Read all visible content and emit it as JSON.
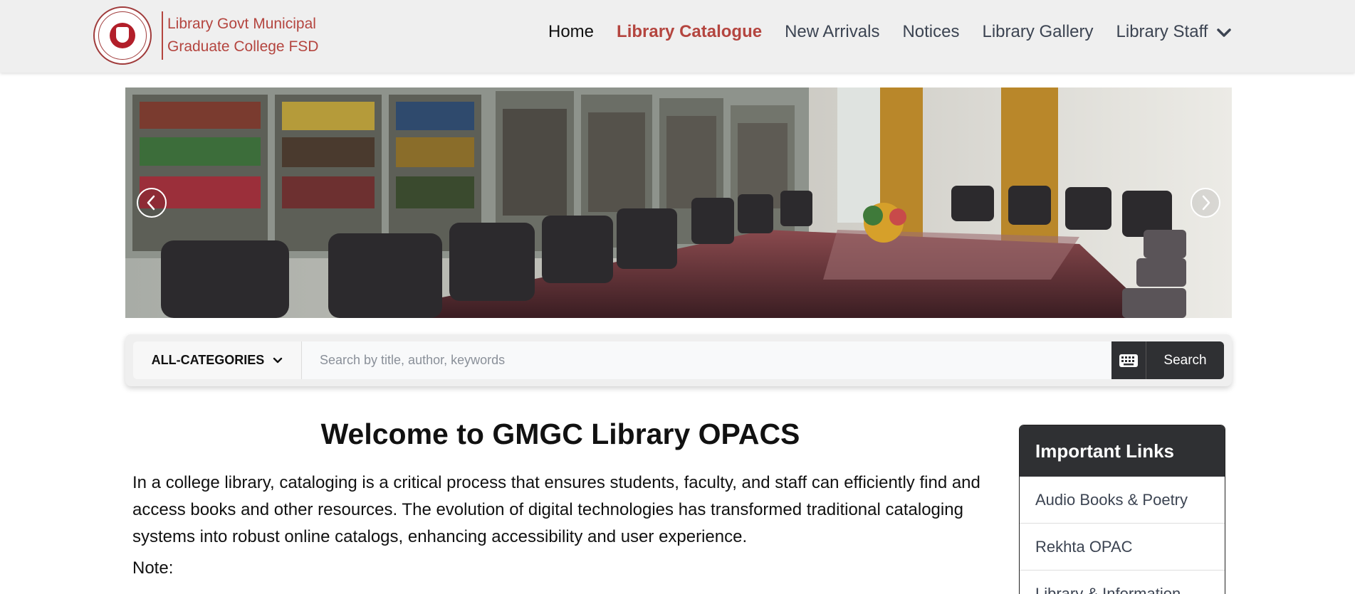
{
  "brand": {
    "line1": "Library Govt Municipal",
    "line2": "Graduate College FSD",
    "logo_icon": "college-seal-icon",
    "color": "#b4453f"
  },
  "nav": {
    "items": [
      {
        "label": "Home"
      },
      {
        "label": "Library Catalogue"
      },
      {
        "label": "New Arrivals"
      },
      {
        "label": "Notices"
      },
      {
        "label": "Library Gallery"
      },
      {
        "label": "Library Staff"
      }
    ],
    "active": "Library Catalogue"
  },
  "carousel": {
    "image": "library reading room with bookshelves and conference table",
    "prev_icon": "chevron-left-icon",
    "next_icon": "chevron-right-icon"
  },
  "search": {
    "category_label": "ALL-CATEGORIES",
    "placeholder": "Search by title, author, keywords",
    "value": "",
    "keyboard_icon": "keyboard-icon",
    "button_label": "Search"
  },
  "main": {
    "title": "Welcome to GMGC Library OPACS",
    "intro": "In a college library, cataloging is a critical process that ensures students, faculty, and staff can efficiently find and access books and other resources. The evolution of digital technologies has transformed traditional cataloging systems into robust online catalogs, enhancing accessibility and user experience.",
    "note_label": "Note:"
  },
  "sidebar": {
    "title": "Important Links",
    "links": [
      {
        "label": "Audio Books & Poetry"
      },
      {
        "label": "Rekhta OPAC"
      },
      {
        "label": "Library & Information"
      }
    ]
  },
  "colors": {
    "accent": "#b4453f",
    "dark": "#2f3033",
    "navbar_bg": "#efefef"
  }
}
